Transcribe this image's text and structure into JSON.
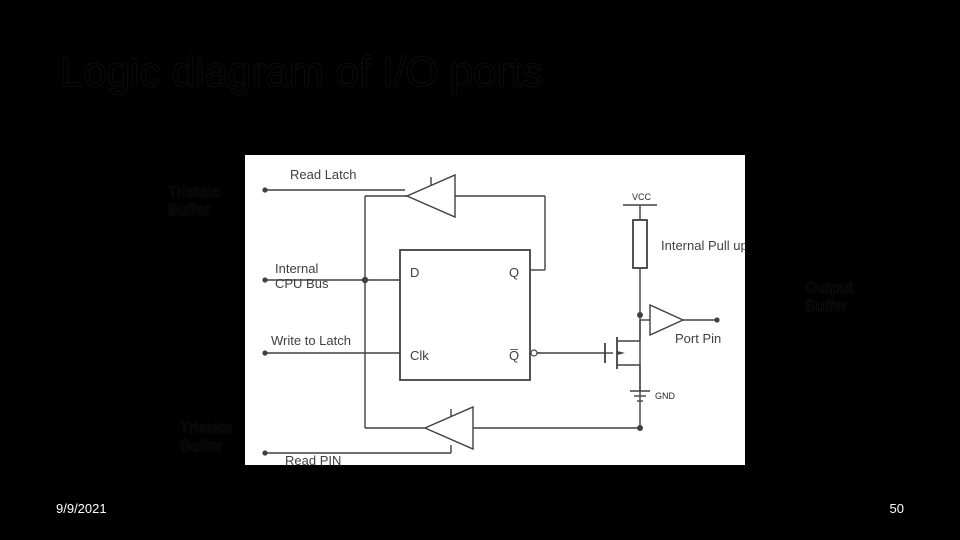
{
  "slide": {
    "title": "Logic diagram of I/O ports",
    "footer_date": "9/9/2021",
    "page_number": "50"
  },
  "callouts": {
    "tristate_top": {
      "line1": "Tristate",
      "line2": "Buffer"
    },
    "tristate_bottom": {
      "line1": "Tristate",
      "line2": "Buffer"
    },
    "output_buffer": {
      "line1": "Output",
      "line2": "Buffer"
    }
  },
  "diagram": {
    "signals": {
      "read_latch": "Read Latch",
      "internal_cpu_bus_l1": "Internal",
      "internal_cpu_bus_l2": "CPU Bus",
      "write_to_latch": "Write to Latch",
      "read_pin": "Read PIN"
    },
    "block": {
      "d": "D",
      "q": "Q",
      "clk": "Clk",
      "qbar": "Q̅"
    },
    "right": {
      "vcc": "VCC",
      "internal_pull_up": "Internal Pull up",
      "port_pin": "Port Pin",
      "gnd": "GND"
    }
  }
}
